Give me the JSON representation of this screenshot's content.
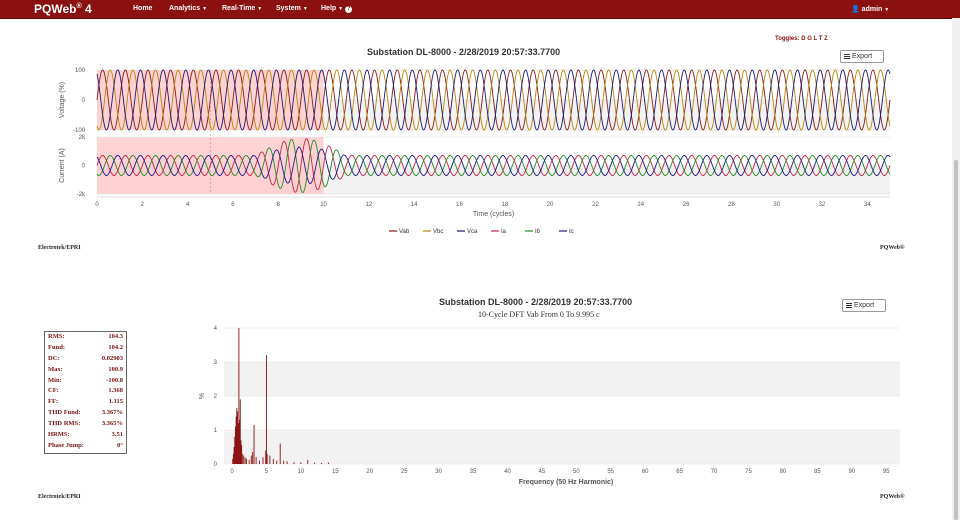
{
  "nav": {
    "brand": "PQWeb",
    "brand_sup": "®",
    "brand_version": " 4",
    "home": "Home",
    "analytics": "Analytics",
    "realtime": "Real-Time",
    "system": "System",
    "help": "Help",
    "user": "admin"
  },
  "colors": {
    "navbar": "#8b1010",
    "Vab": "#8b1a1a",
    "Vbc": "#b8860b",
    "Vca": "#1a1a6e",
    "Ia": "#cc2244",
    "Ib": "#228b22",
    "Ic": "#1a1a8b"
  },
  "waveform": {
    "title": "Substation DL-8000 - 2/28/2019 20:57:33.7700",
    "toggles": "Toggles: D G L T Z",
    "export_label": "Export",
    "footer_left": "Electrotek/EPRI",
    "footer_right": "PQWeb®"
  },
  "spectrum": {
    "title": "Substation DL-8000 - 2/28/2019 20:57:33.7700",
    "subtitle": "10-Cycle DFT Vab From 0 To 9.995 c",
    "export_label": "Export",
    "footer_left": "Electrotek/EPRI",
    "footer_right": "PQWeb®"
  },
  "stats": [
    {
      "label": "RMS:",
      "value": "104.3"
    },
    {
      "label": "Fund:",
      "value": "104.2"
    },
    {
      "label": "DC:",
      "value": "0.02903"
    },
    {
      "label": "Max:",
      "value": "100.9"
    },
    {
      "label": "Min:",
      "value": "-100.8"
    },
    {
      "label": "CF:",
      "value": "1.368"
    },
    {
      "label": "FF:",
      "value": "1.115"
    },
    {
      "label": "THD Fund:",
      "value": "3.367%"
    },
    {
      "label": "THD RMS:",
      "value": "3.365%"
    },
    {
      "label": "HRMS:",
      "value": "3.51"
    },
    {
      "label": "Phase Jump:",
      "value": "0°"
    }
  ],
  "chart_data": [
    {
      "type": "line",
      "panel": "voltage",
      "ylabel": "Voltage (%)",
      "ylim": [
        -100,
        100
      ],
      "yticks": [
        "100",
        "0",
        "-100"
      ],
      "xlim": [
        0,
        35
      ],
      "highlight_x": [
        0,
        10
      ],
      "series": [
        {
          "name": "Vab",
          "amplitude": 100,
          "phase_deg": 0
        },
        {
          "name": "Vbc",
          "amplitude": 100,
          "phase_deg": -120
        },
        {
          "name": "Vca",
          "amplitude": 100,
          "phase_deg": 120
        }
      ]
    },
    {
      "type": "line",
      "panel": "current",
      "ylabel": "Current (A)",
      "xlabel": "Time (cycles)",
      "ylim": [
        -2000,
        2000
      ],
      "yticks": [
        "2k",
        "0",
        "-2k"
      ],
      "xlim": [
        0,
        35
      ],
      "xticks": [
        "0",
        "2",
        "4",
        "6",
        "8",
        "10",
        "12",
        "14",
        "16",
        "18",
        "20",
        "22",
        "24",
        "26",
        "28",
        "30",
        "32",
        "34"
      ],
      "highlight_x": [
        0,
        10
      ],
      "series": [
        {
          "name": "Ia",
          "amplitude": 700,
          "phase_deg": 0
        },
        {
          "name": "Ib",
          "amplitude": 700,
          "phase_deg": -120
        },
        {
          "name": "Ic",
          "amplitude": 700,
          "phase_deg": 120
        }
      ],
      "fault": {
        "start": 7,
        "end": 11,
        "peak": 1900
      }
    },
    {
      "type": "bar",
      "panel": "spectrum",
      "ylabel": "%",
      "xlabel": "Frequency (50 Hz Harmonic)",
      "ylim": [
        0,
        4
      ],
      "yticks": [
        "0",
        "1",
        "2",
        "3",
        "4"
      ],
      "xlim": [
        0,
        97
      ],
      "xticks": [
        "0",
        "5",
        "10",
        "15",
        "20",
        "25",
        "30",
        "35",
        "40",
        "45",
        "50",
        "55",
        "60",
        "65",
        "70",
        "75",
        "80",
        "85",
        "90",
        "95"
      ],
      "x": [
        0.1,
        0.2,
        0.3,
        0.4,
        0.5,
        0.6,
        0.7,
        0.8,
        0.9,
        1.0,
        1.1,
        1.2,
        1.3,
        1.4,
        1.5,
        1.7,
        1.9,
        2.1,
        2.5,
        2.8,
        3.0,
        3.2,
        3.5,
        4.0,
        4.5,
        4.9,
        5.0,
        5.1,
        5.5,
        6.0,
        6.5,
        7.0,
        7.5,
        8.0,
        9.0,
        10.0,
        11.0,
        12.0,
        13.0,
        14.0
      ],
      "values": [
        0.15,
        0.3,
        0.5,
        0.8,
        1.1,
        1.4,
        1.65,
        1.55,
        1.2,
        4.0,
        1.3,
        1.9,
        0.7,
        0.55,
        0.3,
        0.25,
        0.2,
        0.15,
        0.12,
        0.25,
        0.35,
        1.15,
        0.2,
        0.1,
        0.2,
        0.4,
        3.2,
        0.3,
        0.25,
        0.15,
        0.1,
        0.6,
        0.1,
        0.08,
        0.05,
        0.05,
        0.12,
        0.04,
        0.03,
        0.04
      ]
    }
  ],
  "legend": [
    "Vab",
    "Vbc",
    "Vca",
    "Ia",
    "Ib",
    "Ic"
  ]
}
